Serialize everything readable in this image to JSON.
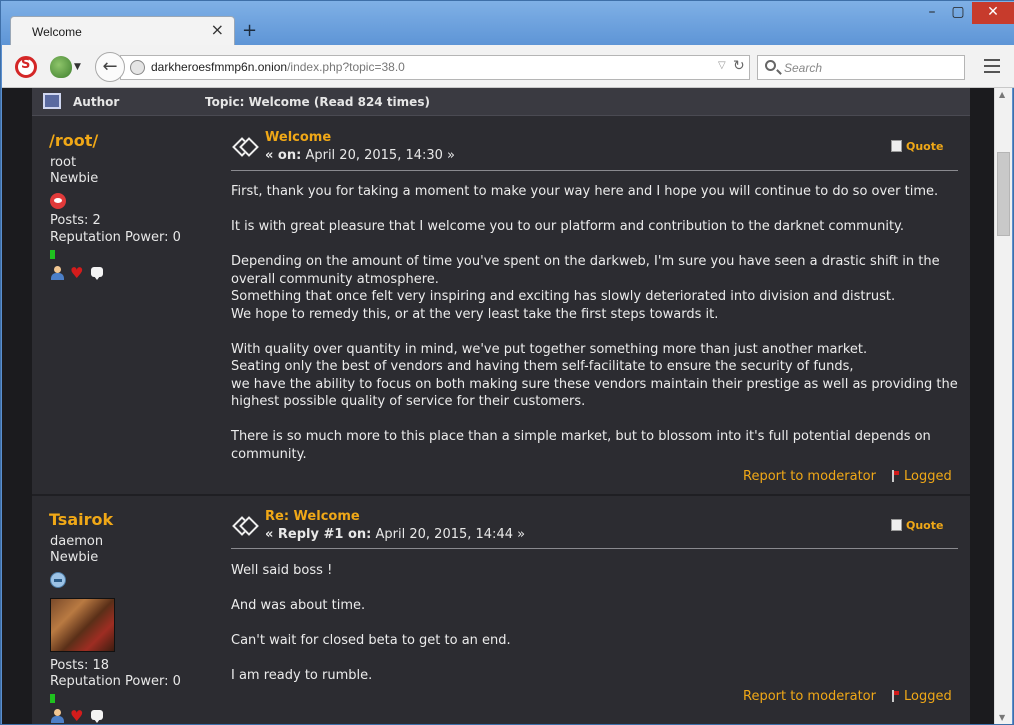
{
  "browser": {
    "tab_title": "Welcome",
    "tab_close": "×",
    "new_tab": "+",
    "url_host": "darkheroesfmmp6n.onion",
    "url_path": "/index.php?topic=38.0",
    "search_placeholder": "Search",
    "window_min": "–",
    "window_max": "▢",
    "window_close": "✕"
  },
  "forum": {
    "header_author": "Author",
    "header_topic": "Topic: Welcome  (Read 824 times)"
  },
  "posts": [
    {
      "poster": "/root/",
      "title": "root",
      "rank": "Newbie",
      "posts": "Posts: 2",
      "reputation": "Reputation Power: 0",
      "subject": "Welcome",
      "date_prefix": "« on:",
      "date": "April 20, 2015, 14:30 »",
      "quote_label": "Quote",
      "body": [
        "First, thank you for taking a moment to make your way here and I hope you will continue to do so over time.",
        "It is with great pleasure that I welcome you to our platform and contribution to the darknet community.",
        "Depending on the amount of time you've spent on the darkweb, I'm sure you have seen a drastic shift in the overall community atmosphere.\nSomething that once felt very inspiring and exciting has slowly deteriorated into division and distrust.\nWe hope to remedy this, or at the very least take the first steps towards it.",
        "With quality over quantity in mind, we've put together something more than just another market.\nSeating only the best of vendors and having them self-facilitate to ensure the security of funds,\nwe have the ability to focus on both making sure these vendors maintain their prestige as well as providing the highest possible quality of service for their customers.",
        "There is so much more to this place than a simple market, but to blossom into it's full potential depends on community."
      ],
      "report_label": "Report to moderator",
      "logged_label": "Logged"
    },
    {
      "poster": "Tsairok",
      "title": "daemon",
      "rank": "Newbie",
      "posts": "Posts: 18",
      "reputation": "Reputation Power: 0",
      "subject": "Re: Welcome",
      "date_prefix": "« Reply #1 on:",
      "date": "April 20, 2015, 14:44 »",
      "quote_label": "Quote",
      "body": [
        "Well said boss !",
        "And was about time.",
        "Can't wait for closed beta to get to an end.",
        "I am ready to rumble."
      ],
      "report_label": "Report to moderator",
      "logged_label": "Logged"
    }
  ]
}
